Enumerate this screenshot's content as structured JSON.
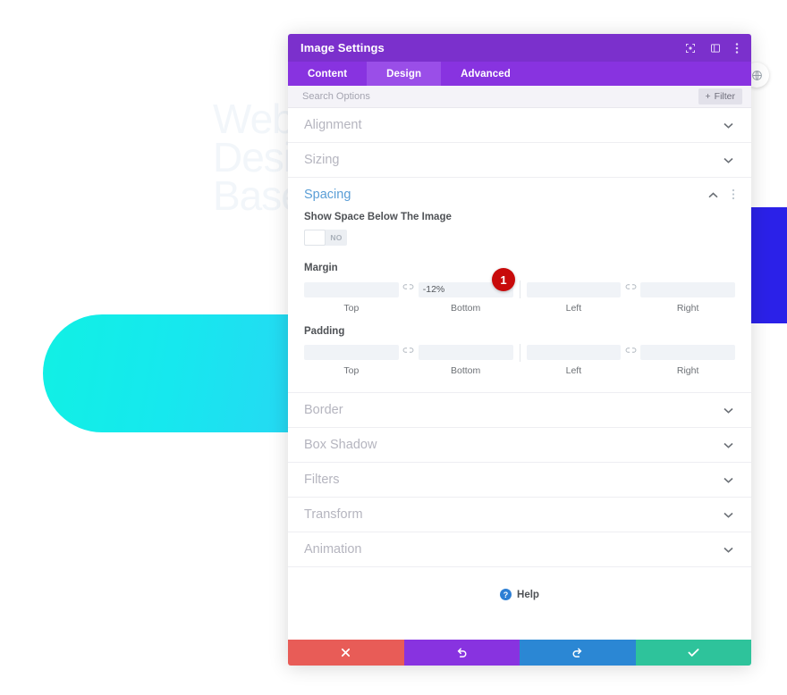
{
  "background": {
    "watermark_text": "Web\nDesi\nBase",
    "hero_shape_name": "cyan-rounded-banner",
    "right_block_name": "blue-column-block"
  },
  "modal": {
    "title": "Image Settings",
    "header_icons": [
      {
        "name": "target-icon",
        "glyph": "☉"
      },
      {
        "name": "layout-panel-icon",
        "glyph": "▣"
      },
      {
        "name": "kebab-menu-icon",
        "glyph": "⋮"
      }
    ],
    "tabs": [
      {
        "label": "Content",
        "active": false
      },
      {
        "label": "Design",
        "active": true
      },
      {
        "label": "Advanced",
        "active": false
      }
    ],
    "search": {
      "placeholder": "Search Options",
      "value": "",
      "filter_label": "Filter",
      "filter_plus": "+"
    },
    "sections": [
      {
        "label": "Alignment",
        "open": false,
        "chevron": "⌄"
      },
      {
        "label": "Sizing",
        "open": false,
        "chevron": "⌄"
      },
      {
        "label": "Spacing",
        "open": true,
        "chevron": "⌃"
      },
      {
        "label": "Border",
        "open": false,
        "chevron": "⌄"
      },
      {
        "label": "Box Shadow",
        "open": false,
        "chevron": "⌄"
      },
      {
        "label": "Filters",
        "open": false,
        "chevron": "⌄"
      },
      {
        "label": "Transform",
        "open": false,
        "chevron": "⌄"
      },
      {
        "label": "Animation",
        "open": false,
        "chevron": "⌄"
      }
    ],
    "spacing": {
      "toggle_label": "Show Space Below The Image",
      "toggle_value": "NO",
      "margin": {
        "label": "Margin",
        "top": {
          "value": "",
          "caption": "Top"
        },
        "bottom": {
          "value": "-12%",
          "caption": "Bottom"
        },
        "left": {
          "value": "",
          "caption": "Left"
        },
        "right": {
          "value": "",
          "caption": "Right"
        }
      },
      "padding": {
        "label": "Padding",
        "top": {
          "value": "",
          "caption": "Top"
        },
        "bottom": {
          "value": "",
          "caption": "Bottom"
        },
        "left": {
          "value": "",
          "caption": "Left"
        },
        "right": {
          "value": "",
          "caption": "Right"
        }
      },
      "link_icon_glyph": "⚭"
    },
    "help": {
      "label": "Help",
      "icon_glyph": "?"
    },
    "actions": [
      {
        "name": "cancel",
        "glyph": "✖",
        "color": "#e85c57"
      },
      {
        "name": "undo",
        "glyph": "↺",
        "color": "#8833e0"
      },
      {
        "name": "redo",
        "glyph": "↻",
        "color": "#2b87d4"
      },
      {
        "name": "save",
        "glyph": "✔",
        "color": "#2ec39b"
      }
    ]
  },
  "annotations": {
    "badge_one": "1"
  },
  "colors": {
    "header_purple": "#7b30cc",
    "tab_purple": "#8833e0",
    "tab_active": "#9a4ee8",
    "accent_blue": "#5a9ed6",
    "badge_red": "#c80a0a"
  }
}
